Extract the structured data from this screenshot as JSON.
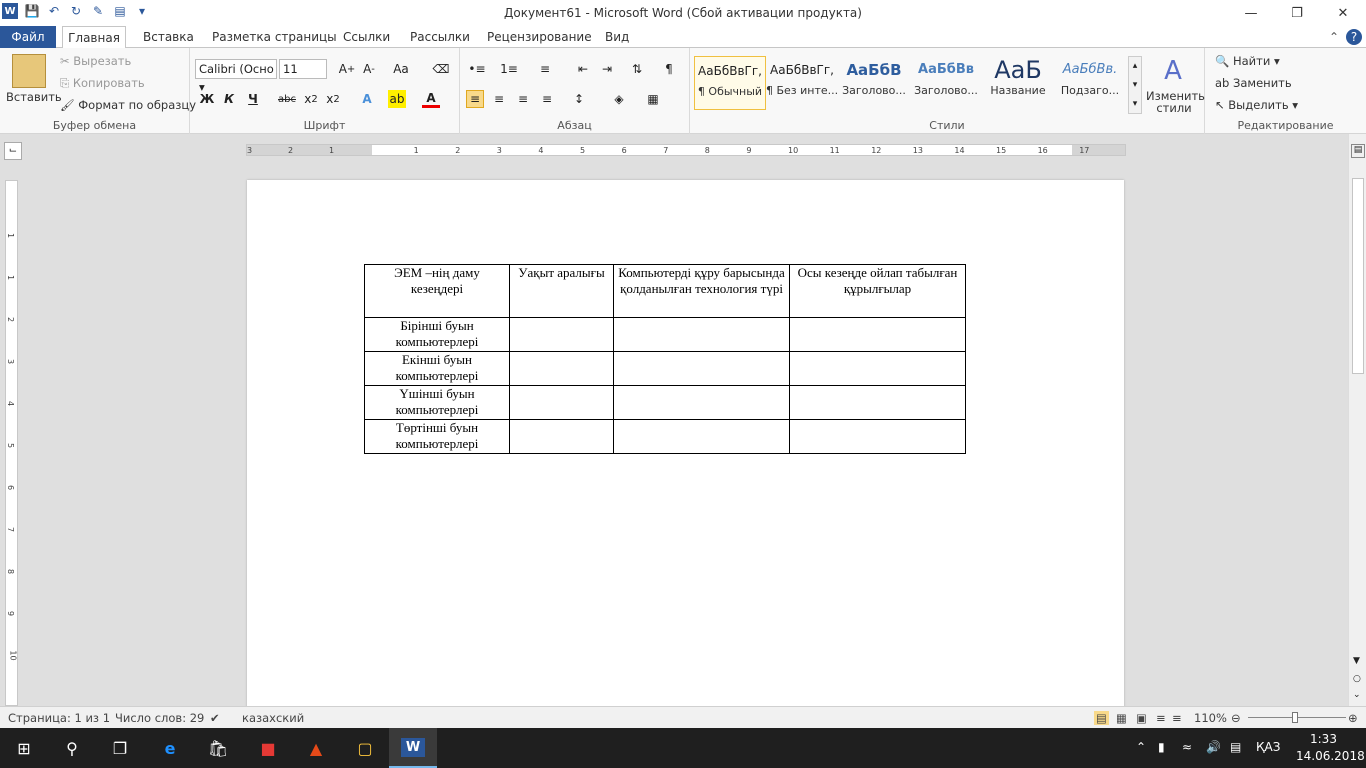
{
  "window": {
    "title": "Документ61  -  Microsoft Word (Сбой активации продукта)"
  },
  "tabs": [
    {
      "label": "Файл"
    },
    {
      "label": "Главная"
    },
    {
      "label": "Вставка"
    },
    {
      "label": "Разметка страницы"
    },
    {
      "label": "Ссылки"
    },
    {
      "label": "Рассылки"
    },
    {
      "label": "Рецензирование"
    },
    {
      "label": "Вид"
    }
  ],
  "clipboard": {
    "paste": "Вставить",
    "cut": "Вырезать",
    "copy": "Копировать",
    "format_painter": "Формат по образцу",
    "label": "Буфер обмена"
  },
  "font": {
    "name": "Calibri (Осно",
    "size": "11",
    "label": "Шрифт",
    "bold": "Ж",
    "italic": "К",
    "underline": "Ч"
  },
  "paragraph": {
    "label": "Абзац"
  },
  "styles": {
    "label": "Стили",
    "items": [
      {
        "preview": "АаБбВвГг,",
        "name": "¶ Обычный"
      },
      {
        "preview": "АаБбВвГг,",
        "name": "¶ Без инте..."
      },
      {
        "preview": "АаБбВ",
        "name": "Заголово..."
      },
      {
        "preview": "АаБбВв",
        "name": "Заголово..."
      },
      {
        "preview": "АаБ",
        "name": "Название"
      },
      {
        "preview": "АаБбВв.",
        "name": "Подзаго..."
      }
    ],
    "change": "Изменить стили"
  },
  "editing": {
    "label": "Редактирование",
    "find": "Найти",
    "replace": "Заменить",
    "select": "Выделить"
  },
  "ruler": {
    "h_ticks": [
      "3",
      "2",
      "1",
      "1",
      "2",
      "3",
      "4",
      "5",
      "6",
      "7",
      "8",
      "9",
      "10",
      "11",
      "12",
      "13",
      "14",
      "15",
      "16",
      "17"
    ],
    "v_ticks": [
      "1",
      "1",
      "2",
      "3",
      "4",
      "5",
      "6",
      "7",
      "8",
      "9",
      "10"
    ]
  },
  "table": {
    "headers": [
      "ЭЕМ –нің даму кезеңдері",
      "Уақыт аралығы",
      "Компьютерді құру барысында қолданылған технология түрі",
      "Осы кезеңде ойлап табылған құрылғылар"
    ],
    "rows": [
      [
        "Бірінші буын компьютерлері",
        "",
        "",
        ""
      ],
      [
        "Екінші буын компьютерлері",
        "",
        "",
        ""
      ],
      [
        "Үшінші буын компьютерлері",
        "",
        "",
        ""
      ],
      [
        "Төртінші буын компьютерлері",
        "",
        "",
        ""
      ]
    ]
  },
  "status": {
    "page": "Страница: 1 из 1",
    "words": "Число слов: 29",
    "language": "казахский",
    "zoom": "110%"
  },
  "tray": {
    "lang": "ҚАЗ",
    "time": "1:33",
    "date": "14.06.2018"
  }
}
